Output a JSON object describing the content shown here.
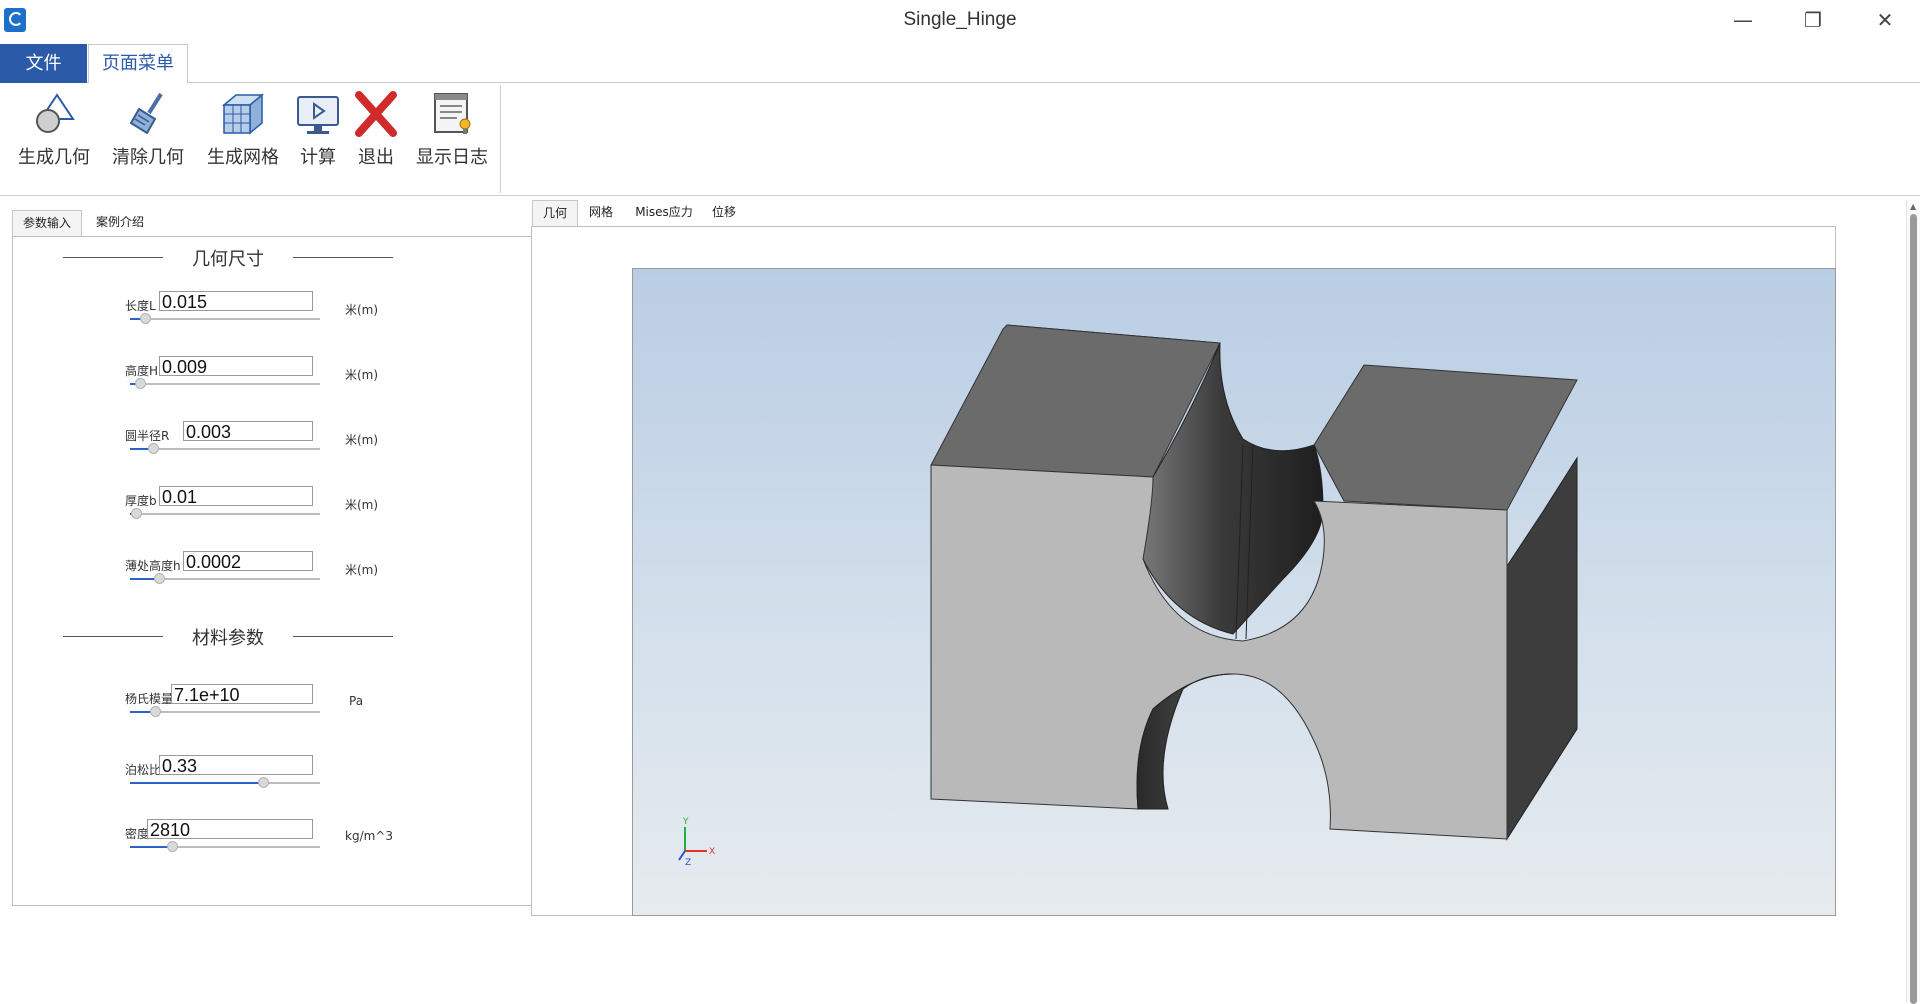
{
  "window": {
    "title": "Single_Hinge",
    "controls": {
      "minimize": "—",
      "restore": "❐",
      "close": "✕"
    }
  },
  "menu": {
    "tabs": [
      {
        "label": "文件"
      },
      {
        "label": "页面菜单"
      }
    ]
  },
  "ribbon": {
    "buttons": [
      {
        "label": "生成几何",
        "icon": "geometry-shapes-icon"
      },
      {
        "label": "清除几何",
        "icon": "broom-icon"
      },
      {
        "label": "生成网格",
        "icon": "mesh-cube-icon"
      },
      {
        "label": "计算",
        "icon": "monitor-play-icon"
      },
      {
        "label": "退出",
        "icon": "red-x-icon"
      },
      {
        "label": "显示日志",
        "icon": "log-document-icon"
      }
    ]
  },
  "left_panel": {
    "tabs": [
      {
        "label": "参数输入"
      },
      {
        "label": "案例介绍"
      }
    ],
    "sections": [
      {
        "title": "几何尺寸",
        "params": [
          {
            "label": "长度L",
            "value": "0.015",
            "unit": "米(m)",
            "slider": 0.08
          },
          {
            "label": "高度H",
            "value": "0.009",
            "unit": "米(m)",
            "slider": 0.05
          },
          {
            "label": "圆半径R",
            "value": "0.003",
            "unit": "米(m)",
            "slider": 0.12
          },
          {
            "label": "厚度b",
            "value": "0.01",
            "unit": "米(m)",
            "slider": 0.03
          },
          {
            "label": "薄处高度h",
            "value": "0.0002",
            "unit": "米(m)",
            "slider": 0.15
          }
        ]
      },
      {
        "title": "材料参数",
        "params": [
          {
            "label": "杨氏模量",
            "value": "7.1e+10",
            "unit": "Pa",
            "slider": 0.13
          },
          {
            "label": "泊松比",
            "value": "0.33",
            "unit": "",
            "slider": 0.7
          },
          {
            "label": "密度",
            "value": "2810",
            "unit": "kg/m^3",
            "slider": 0.22
          }
        ]
      }
    ]
  },
  "viewer": {
    "tabs": [
      {
        "label": "几何"
      },
      {
        "label": "网格"
      },
      {
        "label": "Mises应力"
      },
      {
        "label": "位移"
      }
    ],
    "axes": {
      "x": "X",
      "y": "Y",
      "z": "Z"
    }
  },
  "colors": {
    "accent": "#2a5aa8",
    "slider_fill": "#2a64c8",
    "model_top": "#6b6b6b",
    "model_front": "#b8b8b8",
    "model_side": "#3d3d3d",
    "axis_x": "#e03030",
    "axis_y": "#20b040",
    "axis_z": "#3050d0"
  }
}
